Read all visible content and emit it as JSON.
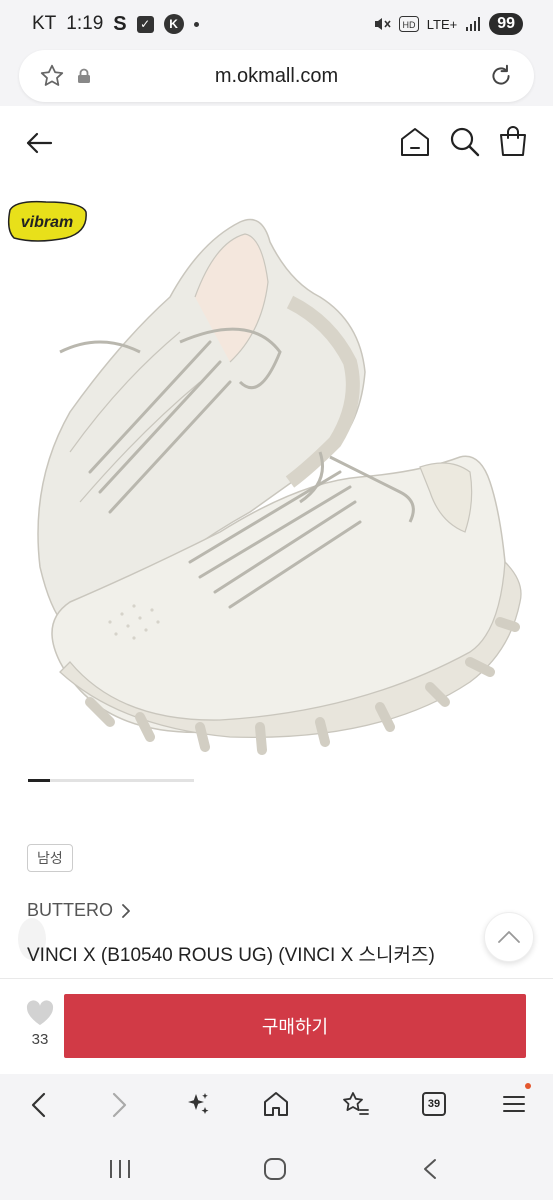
{
  "status_bar": {
    "carrier": "KT",
    "time": "1:19",
    "s_glyph": "S",
    "k_glyph": "K",
    "network": "LTE+",
    "battery": "99"
  },
  "url_bar": {
    "url": "m.okmall.com"
  },
  "icons": {
    "favorite": "star-outline-icon",
    "lock": "lock-icon",
    "reload": "reload-icon",
    "back": "arrow-left-icon",
    "home": "home-icon",
    "search": "search-icon",
    "bag": "shopping-bag-icon",
    "like": "heart-icon",
    "scroll_top": "chevron-up-icon"
  },
  "product": {
    "image_logo": "vibram",
    "gender_tag": "남성",
    "brand": "BUTTERO",
    "title": "VINCI X (B10540 ROUS UG) (VINCI X 스니커즈)",
    "image_count_progress": 0.13
  },
  "buy_bar": {
    "like_count": "33",
    "buy_label": "구매하기"
  },
  "browser_toolbar": {
    "tabs_count": "39"
  },
  "colors": {
    "buy_button": "#d13a46",
    "logo_yellow": "#e8e01a"
  }
}
